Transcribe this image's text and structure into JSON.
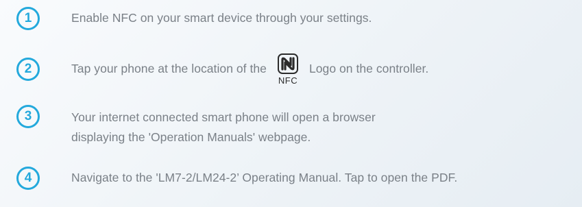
{
  "steps": [
    {
      "number": "1",
      "text": "Enable NFC on your smart device through your settings."
    },
    {
      "number": "2",
      "text_before": "Tap your phone at the location of the",
      "logo_label": "NFC",
      "logo_icon": "nfc-n-mark-icon",
      "text_after": "Logo on the controller."
    },
    {
      "number": "3",
      "line1": "Your internet connected smart phone will open a browser",
      "line2": "displaying the 'Operation Manuals' webpage."
    },
    {
      "number": "4",
      "text": "Navigate to the 'LM7-2/LM24-2’ Operating Manual. Tap to open the PDF."
    }
  ],
  "colors": {
    "accent": "#24a9dc",
    "text": "#7a8087",
    "logo": "#2b2b2b"
  }
}
